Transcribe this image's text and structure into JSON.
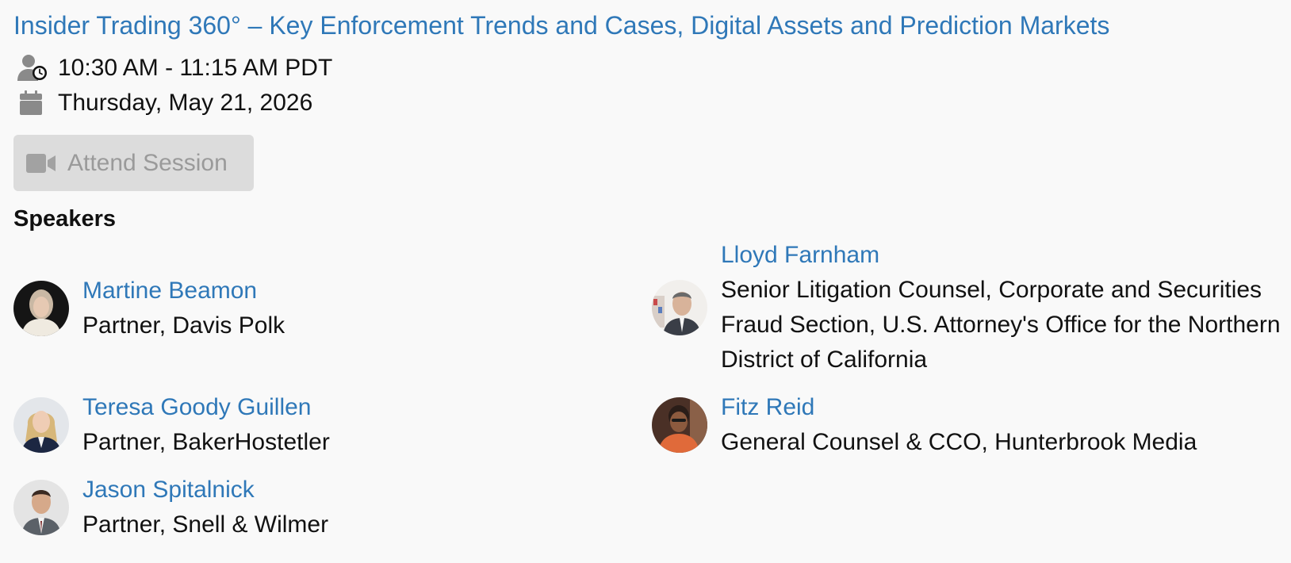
{
  "session": {
    "title": "Insider Trading 360° – Key Enforcement Trends and Cases, Digital Assets and Prediction Markets",
    "time": "10:30 AM - 11:15 AM PDT",
    "date": "Thursday, May 21, 2026",
    "attend_label": "Attend Session"
  },
  "speakers_heading": "Speakers",
  "speakers": [
    {
      "name": "Martine Beamon",
      "role": "Partner, Davis Polk"
    },
    {
      "name": "Lloyd Farnham",
      "role": "Senior Litigation Counsel, Corporate and Securities Fraud Section, U.S. Attorney's Office for the Northern District of California"
    },
    {
      "name": "Teresa Goody Guillen",
      "role": "Partner, BakerHostetler"
    },
    {
      "name": "Fitz Reid",
      "role": "General Counsel & CCO, Hunterbrook Media"
    },
    {
      "name": "Jason Spitalnick",
      "role": "Partner, Snell & Wilmer"
    }
  ],
  "icons": {
    "time": "user-clock-icon",
    "date": "calendar-icon",
    "attend": "video-camera-icon"
  },
  "colors": {
    "link": "#2f78b8",
    "button_bg": "#dcdcdc",
    "button_text": "#9a9a9a",
    "icon": "#8a8a8a"
  }
}
